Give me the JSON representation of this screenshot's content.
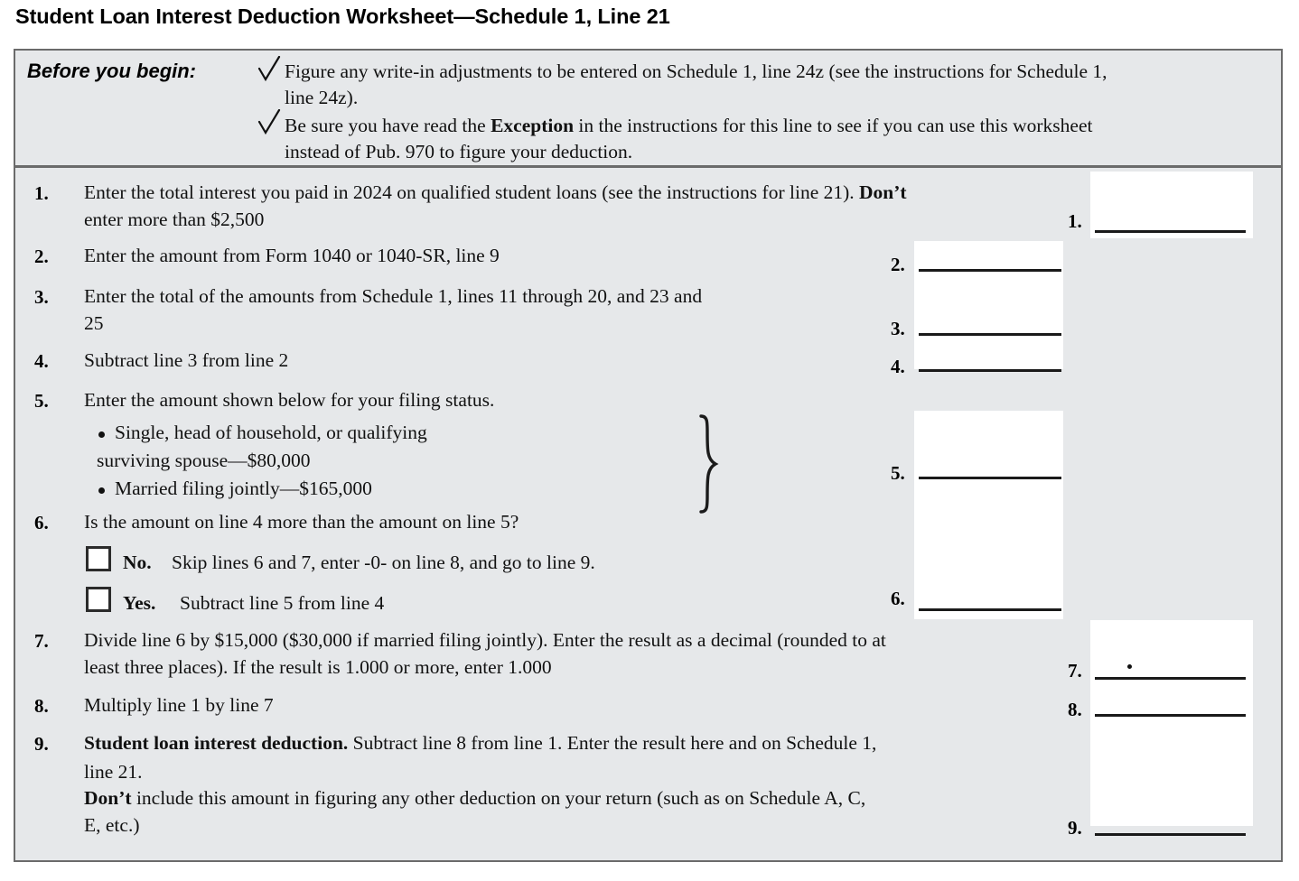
{
  "title": "Student Loan Interest Deduction Worksheet—Schedule 1, Line 21",
  "before_you_begin": {
    "label": "Before you begin:",
    "items": [
      {
        "icon": "checkmark-icon",
        "line1_a": "Figure any write-in adjustments to be entered on Schedule 1, line 24z (see the instructions for Schedule 1,",
        "line1_b": "line 24z)."
      },
      {
        "icon": "checkmark-icon",
        "line2_a_pre": "Be sure you have read the ",
        "line2_a_bold": "Exception",
        "line2_a_post": " in the instructions for this line to see if you can use this worksheet",
        "line2_b": "instead of Pub. 970 to figure your deduction."
      }
    ]
  },
  "lines": {
    "l1": {
      "number": "1.",
      "text_a_pre": "Enter the total interest you paid in 2024 on qualified student loans (see the instructions for line 21). ",
      "text_a_bold": "Don’t",
      "text_b": "enter more than $2,500",
      "answer_number": "1.",
      "value": ""
    },
    "l2": {
      "number": "2.",
      "text": "Enter the amount from Form 1040 or 1040-SR, line 9",
      "answer_number": "2.",
      "value": ""
    },
    "l3": {
      "number": "3.",
      "text_a": "Enter the total of the amounts from Schedule 1, lines 11 through 20, and 23 and",
      "text_b": "25",
      "answer_number": "3.",
      "value": ""
    },
    "l4": {
      "number": "4.",
      "text": "Subtract line 3 from line 2",
      "answer_number": "4.",
      "value": ""
    },
    "l5": {
      "number": "5.",
      "text": "Enter the amount shown below for your filing status.",
      "bullets": [
        "Single, head of household, or qualifying",
        "surviving spouse—$80,000",
        "Married filing jointly—$165,000"
      ],
      "answer_number": "5.",
      "value": ""
    },
    "l6": {
      "number": "6.",
      "text": "Is the amount on line 4 more than the amount on line 5?",
      "option_no_label": "No.",
      "option_no_text": "Skip lines 6 and 7, enter -0- on line 8, and go to line 9.",
      "option_yes_label": "Yes.",
      "option_yes_text": "Subtract line 5 from line 4",
      "answer_number": "6.",
      "value": "",
      "no_checked": false,
      "yes_checked": false
    },
    "l7": {
      "number": "7.",
      "text_a": "Divide line 6 by $15,000 ($30,000 if married filing jointly). Enter the result as a decimal (rounded to at",
      "text_b": "least three places). If the result is 1.000 or more, enter 1.000",
      "answer_number": "7.",
      "value": ""
    },
    "l8": {
      "number": "8.",
      "text": "Multiply line 1 by line 7",
      "answer_number": "8.",
      "value": ""
    },
    "l9": {
      "number": "9.",
      "text_a_bold": "Student loan interest deduction.",
      "text_a_post": " Subtract line 8 from line 1. Enter the result here and on Schedule 1,",
      "text_b": "line 21.",
      "text_c_bold": "Don’t",
      "text_c_post": " include this amount in figuring any other deduction on your return (such as on Schedule A, C,",
      "text_d": "E, etc.)",
      "answer_number": "9.",
      "value": ""
    }
  },
  "colors": {
    "page_background": "#ffffff",
    "panel_background": "#e6e8ea",
    "border": "#6b6b6b",
    "text": "#111111",
    "answer_box": "#ffffff",
    "answer_rule": "#1a1a1a"
  }
}
